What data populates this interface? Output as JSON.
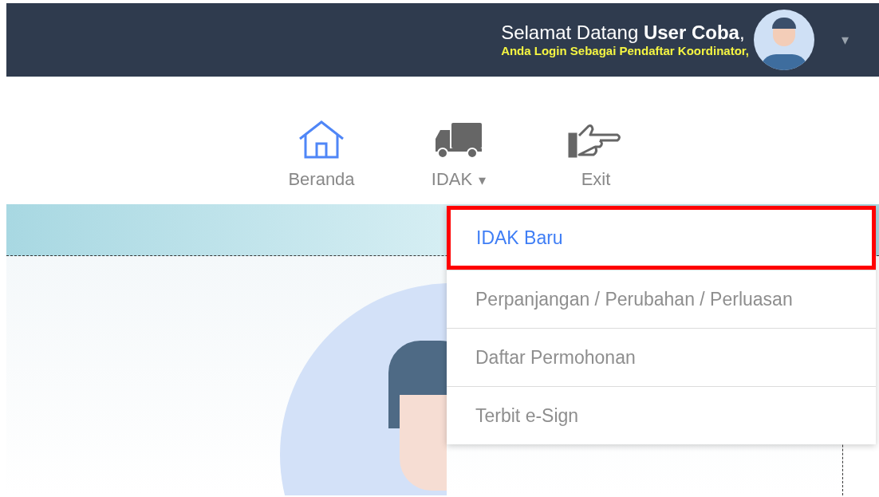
{
  "header": {
    "greeting": "Selamat Datang",
    "user": "User Coba",
    "user_suffix": ",",
    "role": "Anda Login Sebagai Pendaftar Koordinator,",
    "menu_caret": "▾"
  },
  "nav": [
    {
      "kind": "home",
      "label": "Beranda"
    },
    {
      "kind": "truck",
      "label": "IDAK",
      "caret": "▾"
    },
    {
      "kind": "hand",
      "label": "Exit"
    }
  ],
  "dropdown": [
    {
      "label": "IDAK Baru",
      "selected": true
    },
    {
      "label": "Perpanjangan / Perubahan / Perluasan",
      "selected": false
    },
    {
      "label": "Daftar Permohonan",
      "selected": false
    },
    {
      "label": "Terbit e-Sign",
      "selected": false
    }
  ]
}
